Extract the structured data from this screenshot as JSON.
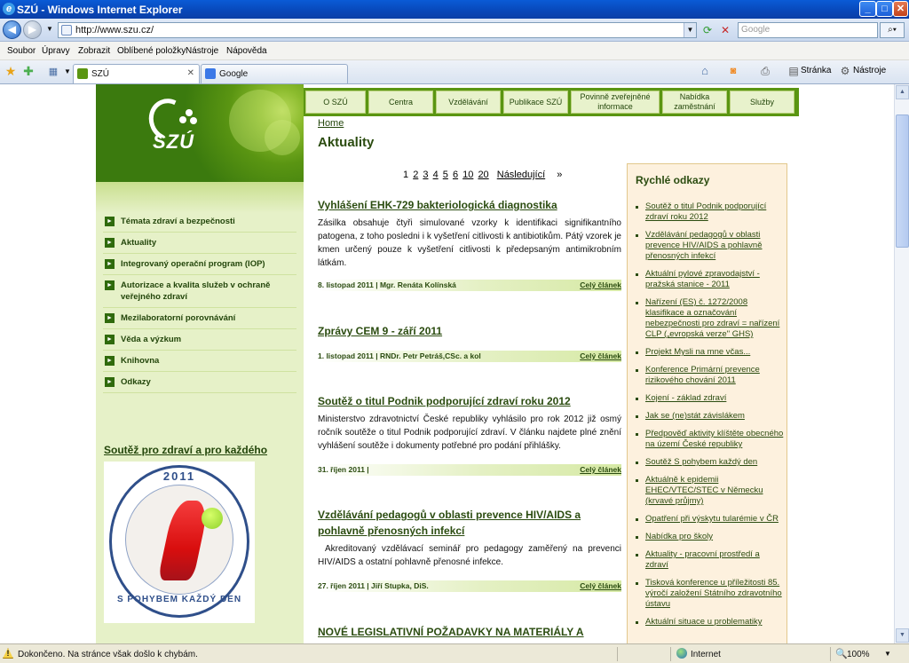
{
  "window": {
    "title": "SZÚ - Windows Internet Explorer"
  },
  "address": {
    "url": "http://www.szu.cz/",
    "search_placeholder": "Google"
  },
  "menu": [
    "Soubor",
    "Úpravy",
    "Zobrazit",
    "Oblíbené položky",
    "Nástroje",
    "Nápověda"
  ],
  "tabs": [
    {
      "label": "SZÚ"
    },
    {
      "label": "Google"
    }
  ],
  "commandbar": {
    "page": "Stránka",
    "tools": "Nástroje"
  },
  "status": {
    "text": "Dokončeno. Na stránce však došlo k chybám.",
    "zone": "Internet",
    "zoom": "100%"
  },
  "site": {
    "logo": "SZÚ",
    "topnav": [
      "O SZÚ",
      "Centra",
      "Vzdělávání",
      "Publikace SZÚ",
      "Povinně zveřejněné informace",
      "Nabídka zaměstnání",
      "Služby"
    ],
    "leftnav": [
      "Témata zdraví a bezpečnosti",
      "Aktuality",
      "Integrovaný operační program (IOP)",
      "Autorizace a kvalita služeb v ochraně veřejného zdraví",
      "Mezilaboratorní porovnávání",
      "Věda a výzkum",
      "Knihovna",
      "Odkazy"
    ],
    "promo": {
      "title": "Soutěž pro zdraví a pro každého",
      "year": "2011",
      "motto": "S POHYBEM KAŽDÝ DEN"
    },
    "breadcrumb": "Home",
    "page_title": "Aktuality",
    "pager": {
      "current": "1",
      "pages": [
        "2",
        "3",
        "4",
        "5",
        "6",
        "10",
        "20"
      ],
      "next": "Následující",
      "last": "»"
    },
    "articles": [
      {
        "title": "Vyhlášení EHK-729 bakteriologická diagnostika",
        "body": "Zásilka obsahuje čtyři simulované vzorky k identifikaci signifikantního patogena, z toho posledni i k vyšetření citlivosti k antibiotikům. Pátý vzorek je kmen určený pouze k vyšetření citlivosti k předepsaným antimikrobním látkám.",
        "meta": "8. listopad 2011 | Mgr. Renáta Kolínská",
        "more": "Celý článek"
      },
      {
        "title": "Zprávy CEM 9 - září 2011",
        "body": "",
        "meta": "1. listopad 2011 | RNDr. Petr Petráš,CSc. a kol",
        "more": "Celý článek"
      },
      {
        "title": "Soutěž o titul Podnik podporující zdraví roku 2012",
        "body": "Ministerstvo zdravotnictví České republiky vyhlásilo pro rok 2012 již osmý ročník soutěže o titul Podnik podporující zdraví. V článku najdete plné znění vyhlášení soutěže i dokumenty potřebné pro podání přihlášky.",
        "meta": "31. říjen 2011 |",
        "more": "Celý článek"
      },
      {
        "title": "Vzdělávání pedagogů v oblasti prevence HIV/AIDS a pohlavně přenosných infekcí",
        "body": "Akreditovaný vzdělávací seminář pro pedagogy zaměřený na prevenci HIV/AIDS a ostatní pohlavně přenosné infekce.",
        "meta": "27. říjen 2011 | Jiří Stupka, DiS.",
        "more": "Celý článek"
      },
      {
        "title": "NOVÉ LEGISLATIVNÍ POŽADAVKY NA MATERIÁLY A",
        "body": "",
        "meta": "",
        "more": ""
      }
    ],
    "quick": {
      "title": "Rychlé odkazy",
      "links": [
        "Soutěž o titul Podnik podporující zdraví roku 2012",
        "Vzdělávání pedagogů v oblasti prevence HIV/AIDS a pohlavně přenosných infekcí",
        "Aktuální pylové zpravodajství - pražská stanice - 2011",
        "Nařízení (ES) č. 1272/2008 klasifikace a označování nebezpečnosti pro zdraví = nařízení CLP („evropská verze\" GHS)",
        "Projekt Mysli na mne včas...",
        "Konference Primární prevence rizikového chování 2011",
        "Kojení - základ zdraví",
        "Jak se (ne)stát závislákem",
        "Předpověď aktivity klíštěte obecného na území České republiky",
        "Soutěž S pohybem každý den",
        "Aktuálně k epidemii EHEC/VTEC/STEC v Německu (krvavé průjmy)",
        "Opatření při výskytu tularémie v ČR",
        "Nabídka pro školy",
        "Aktuality - pracovní prostředí a zdraví",
        "Tisková konference u příležitosti 85. výročí založení Státního zdravotního ústavu",
        "Aktuální situace u problematiky"
      ]
    }
  }
}
